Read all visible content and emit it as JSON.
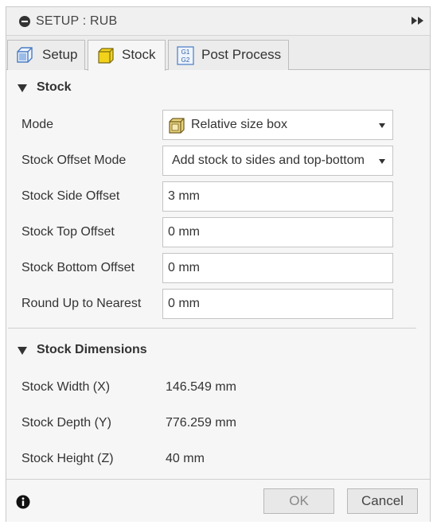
{
  "window": {
    "title": "SETUP : RUB"
  },
  "tabs": [
    {
      "label": "Setup",
      "icon": "setup-cube-icon"
    },
    {
      "label": "Stock",
      "icon": "stock-box-icon",
      "active": true
    },
    {
      "label": "Post Process",
      "icon": "gcode-g1-g2-icon",
      "icon_text_1": "G1",
      "icon_text_2": "G2"
    }
  ],
  "stock_section": {
    "title": "Stock",
    "mode": {
      "label": "Mode",
      "value": "Relative size box",
      "icon": "relative-box-icon"
    },
    "offset_mode": {
      "label": "Stock Offset Mode",
      "value": "Add stock to sides and top-bottom"
    },
    "side_offset": {
      "label": "Stock Side Offset",
      "value": "3 mm"
    },
    "top_offset": {
      "label": "Stock Top Offset",
      "value": "0 mm"
    },
    "bottom_offset": {
      "label": "Stock Bottom Offset",
      "value": "0 mm"
    },
    "round_up": {
      "label": "Round Up to Nearest",
      "value": "0 mm"
    }
  },
  "dimensions_section": {
    "title": "Stock Dimensions",
    "width": {
      "label": "Stock Width (X)",
      "value": "146.549 mm"
    },
    "depth": {
      "label": "Stock Depth (Y)",
      "value": "776.259 mm"
    },
    "height": {
      "label": "Stock Height (Z)",
      "value": "40 mm"
    }
  },
  "footer": {
    "ok_label": "OK",
    "cancel_label": "Cancel"
  },
  "colors": {
    "box_yellow": "#f2d21b",
    "setup_blue": "#5b8fd6",
    "panel_bg": "#f6f6f6"
  }
}
